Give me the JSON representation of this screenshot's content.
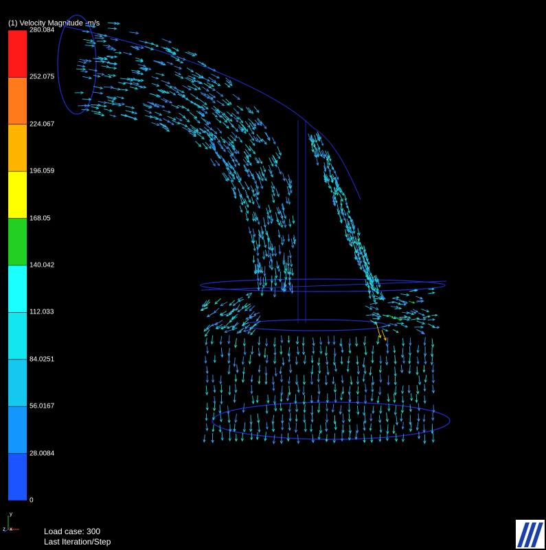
{
  "legend": {
    "title": "(1) Velocity Magnitude -m/s",
    "ticks": [
      "280.084",
      "252.075",
      "224.067",
      "196.059",
      "168.05",
      "140.042",
      "112.033",
      "84.0251",
      "56.0167",
      "28.0084",
      "0"
    ],
    "colors": [
      "#ff1a1a",
      "#ff7a1a",
      "#ffb400",
      "#ffff00",
      "#22d022",
      "#1affff",
      "#14e6f0",
      "#14c8f0",
      "#1496ff",
      "#1a55ff",
      "#1212ff"
    ]
  },
  "status": {
    "load_case": "Load case: 300",
    "iteration": "Last Iteration/Step"
  },
  "triad": {
    "y_label": "y",
    "x_label": "x",
    "z_label": "z"
  },
  "viewport": {
    "outline_color": "#1e2fd8",
    "arrow_palette": [
      "#19d6e6",
      "#2bb8e8",
      "#3a8cf0",
      "#27e0d0",
      "#44a8f4"
    ],
    "hot_spot_colors": [
      "#ffd000",
      "#22d022"
    ]
  }
}
